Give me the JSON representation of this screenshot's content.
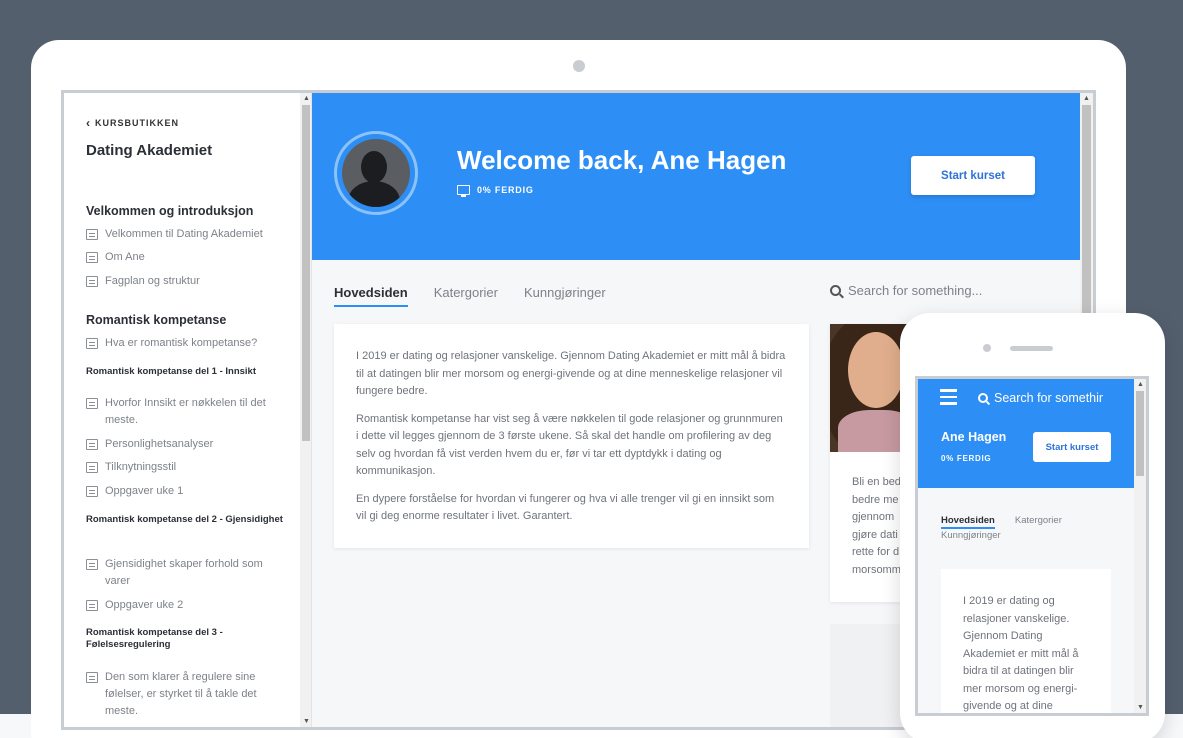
{
  "sidebar": {
    "back_label": "KURSBUTIKKEN",
    "course_title": "Dating Akademiet",
    "sections": [
      {
        "title": "Velkommen og introduksjon"
      },
      {
        "title": "Romantisk kompetanse"
      }
    ],
    "lessons": [
      "Velkommen til Dating Akademiet",
      "Om Ane",
      "Fagplan og struktur",
      "Hva er romantisk kompetanse?",
      "Hvorfor Innsikt er nøkkelen til det meste.",
      "Personlighetsanalyser",
      "Tilknytningsstil",
      "Oppgaver uke 1",
      "Gjensidighet skaper forhold som varer",
      "Oppgaver uke 2",
      "Den som klarer å regulere sine følelser, er styrket til å takle det meste."
    ],
    "subsections": [
      "Romantisk kompetanse del 1 - Innsikt",
      "Romantisk kompetanse del 2 - Gjensidighet",
      "Romantisk kompetanse del 3 - Følelsesregulering"
    ]
  },
  "hero": {
    "welcome": "Welcome back, Ane Hagen",
    "progress_label": "0% FERDIG",
    "progress_value": 0,
    "start_button": "Start kurset",
    "accent_color": "#2d8ef5"
  },
  "tabs": [
    "Hovedsiden",
    "Katergorier",
    "Kunngjøringer"
  ],
  "search": {
    "placeholder": "Search for something..."
  },
  "intro_paragraphs": [
    "I 2019 er dating og relasjoner vanskelige. Gjennom Dating Akademiet er mitt mål å bidra til at datingen blir mer morsom og energi-givende og at dine menneskelige relasjoner vil fungere bedre.",
    "Romantisk kompetanse har vist seg å være nøkkelen til gode relasjoner og grunnmuren i dette vil legges gjennom de 3 første ukene. Så skal det handle om profilering av deg selv og hvordan få vist verden hvem du er, før vi tar ett dyptdykk i dating og kommunikasjon.",
    "En dypere forståelse for hvordan vi fungerer og hva vi alle trenger vil gi en innsikt som vil gi deg enorme resultater i livet. Garantert."
  ],
  "side_card_lines": [
    "Bli en bed",
    "bedre me",
    "gjennom",
    "gjøre dati",
    "rette for d",
    "morsomm"
  ],
  "mobile": {
    "search_text": "Search for somethir",
    "name": "Ane Hagen",
    "progress_label": "0% FERDIG",
    "start_button": "Start kurset",
    "tabs": [
      "Hovedsiden",
      "Katergorier",
      "Kunngjøringer"
    ],
    "card_lines": [
      "I 2019 er dating og",
      "relasjoner vanskelige.",
      "Gjennom Dating",
      "Akademiet er mitt mål å",
      "bidra til at datingen blir",
      "mer morsom og energi-",
      "givende og at dine"
    ]
  }
}
